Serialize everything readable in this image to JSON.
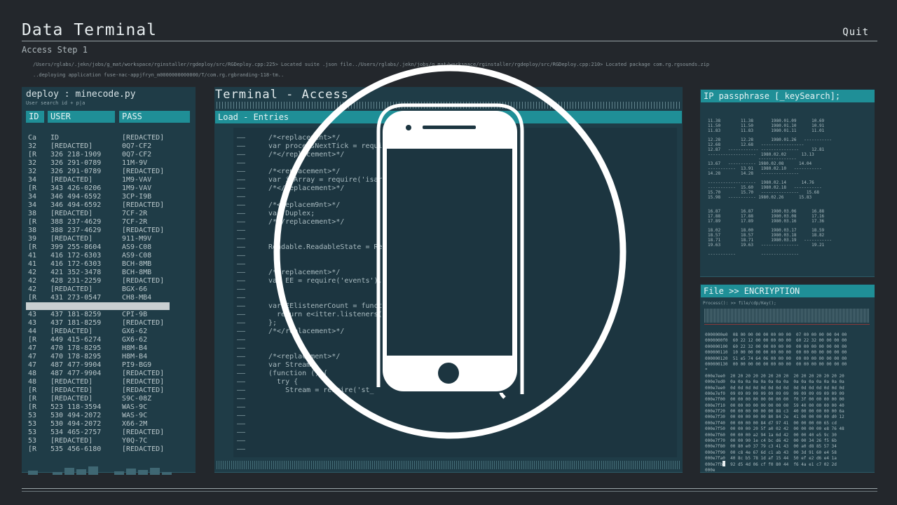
{
  "window": {
    "title": "Data Terminal",
    "quit_label": "Quit",
    "step": "Access Step 1"
  },
  "paths": [
    "/Users/rglabs/.jekn/jobs/g_mat/workspace/rginstaller/rgdeploy/src/RGDeploy.cpp:225> Located suite .json file../Users/rglabs/.jekn/jobs/g_mat/workspace/rginstaller/rgdeploy/src/RGDeploy.cpp:210> Located package com.rg.rgsounds.zip",
    "..deploying application fuse-nac-appjfryn_m0000000000000/T/com.rg.rgbranding-118-tm.."
  ],
  "deploy": {
    "title": "deploy : minecode.py",
    "subtitle": "User search id + p|a",
    "columns": [
      "ID",
      "USER",
      "PASS"
    ],
    "rows": [
      [
        "Ca",
        "ID",
        "[REDACTED]"
      ],
      [
        "32",
        "[REDACTED]",
        "0Q7-CF2"
      ],
      [
        "[R",
        "326 218-1909",
        "0Q7-CF2"
      ],
      [
        "32",
        "326 291-0789",
        "11M-9V"
      ],
      [
        "32",
        "326 291-0789",
        "[REDACTED]"
      ],
      [
        "34",
        "[REDACTED]",
        "1M9-VAV"
      ],
      [
        "[R",
        "343 426-0206",
        "1M9-VAV"
      ],
      [
        "34",
        "346 494-6592",
        "3CP-I9B"
      ],
      [
        "34",
        "346 494-6592",
        "[REDACTED]"
      ],
      [
        "38",
        "[REDACTED]",
        "7CF-2R"
      ],
      [
        "[R",
        "388 237-4629",
        "7CF-2R"
      ],
      [
        "38",
        "388 237-4629",
        "[REDACTED]"
      ],
      [
        "39",
        "[REDACTED]",
        "911-M9V"
      ],
      [
        "[R",
        "399 255-8604",
        "AS9-C08"
      ],
      [
        "41",
        "416 172-6303",
        "AS9-C08"
      ],
      [
        "41",
        "416 172-6303",
        "BCH-8MB"
      ],
      [
        "42",
        "421 352-3478",
        "BCH-8MB"
      ],
      [
        "42",
        "428 231-2259",
        "[REDACTED]"
      ],
      [
        "42",
        "[REDACTED]",
        "BGX-66"
      ],
      [
        "[R",
        "431 273-0547",
        "CH8-MB4"
      ],
      [
        "",
        "",
        ""
      ],
      [
        "43",
        "437 181-8259",
        "CPI-9B"
      ],
      [
        "43",
        "437 181-8259",
        "[REDACTED]"
      ],
      [
        "44",
        "[REDACTED]",
        "GX6-62"
      ],
      [
        "[R",
        "449 415-6274",
        "GX6-62"
      ],
      [
        "47",
        "470 178-8295",
        "H8M-B4"
      ],
      [
        "47",
        "470 178-8295",
        "H8M-B4"
      ],
      [
        "47",
        "487 477-9904",
        "PI9-BG9"
      ],
      [
        "48",
        "487 477-9904",
        "[REDACTED]"
      ],
      [
        "48",
        "[REDACTED]",
        "[REDACTED]"
      ],
      [
        "[R",
        "[REDACTED]",
        "[REDACTED]"
      ],
      [
        "[R",
        "[REDACTED]",
        "S9C-08Z"
      ],
      [
        "[R",
        "523 118-3594",
        "WAS-9C"
      ],
      [
        "53",
        "530 494-2072",
        "WAS-9C"
      ],
      [
        "53",
        "530 494-2072",
        "X66-2M"
      ],
      [
        "53",
        "534 465-2757",
        "[REDACTED]"
      ],
      [
        "53",
        "[REDACTED]",
        "Y0Q-7C"
      ],
      [
        "[R",
        "535 456-6180",
        "[REDACTED]"
      ]
    ]
  },
  "terminal": {
    "title": "Terminal - Access",
    "section": "Load - Entries",
    "dash": "——",
    "code": [
      "/*<replacement>*/",
      "var processNextTick = require('process-nextick-args');",
      "/*</replacement>*/",
      "",
      "/*<replacement>*/",
      "var isArray = require('isarray');",
      "/*</replacement>*/",
      "",
      "/*<replacem9nt>*/",
      "var Duplex;",
      "/*</replacement>*/",
      "",
      "",
      "Readable.ReadableState = ReadableState;",
      "",
      "",
      "/*<replacement>*/",
      "var EE = require('events').EventEmitter;",
      "",
      "",
      "var EElistenerCount = function (emitter, type) {",
      "  return e<itter.listeners(type).length;",
      "};",
      "/*</replacement>*/",
      "",
      "",
      "/*<replacement>*/",
      "var Stream;",
      "(function () {",
      "  try {",
      "    Stream = require('st_"
    ]
  },
  "ip": {
    "title": "IP passphrase [_keySearch];",
    "rows": [
      "11.38        11.38       1980.01.09      10.69",
      "11.50        11.50       1980.01.10      10.91",
      "11.83        11.83       1980.01.11      11.01",
      "",
      "12.28        12.28       1980.01.26   -----------",
      "12.68        12.68   -----------------",
      "12.87   ------------ ---------------     12.81",
      "-------------------  1980.02.02      13.13",
      "                    ---------------",
      "13.67   ----------- 1980.02.08      14.04",
      "-----------  13.91   1980.02.10   -----------",
      "14.28        14.28   ---------------",
      "",
      "-------------------  1980.02.14      14.76",
      "-----------  15.60   1980.02.18   -----------",
      "15.70        15.70   ---------------   15.68",
      "15.98   ----------- 1980.02.26      15.83",
      "",
      "",
      "16.87        16.87       1980.03.06      16.88",
      "17.88        17.88       1980.03.08      17.16",
      "17.89        17.89       1980.03.16      17.36",
      "",
      "18.02        18.00       1980.03.17      18.59",
      "18.57        18.57       1980.03.18      18.82",
      "18.71        18.71       1980.03.19   -----------",
      "19.63        19.63   ---------------     19.21",
      "",
      "-----------          ---------------"
    ]
  },
  "encryption": {
    "title": "File >> ENCRIYPTION",
    "subtitle": "Process(): >> file/cdp/Key();",
    "hex": [
      "0000000e0  08 00 00 00 00 00 00 00  07 00 00 00 00 04 00",
      "0000000f0  60 22 12 00 00 00 00 00  60 22 32 00 00 00 00",
      "000000100  60 22 32 00 00 00 00 00  00 00 00 00 00 00 00",
      "000000110  10 00 00 00 00 00 00 00  00 00 00 00 00 00 00",
      "000000120  51 e5 74 64 06 00 00 00  00 00 00 00 00 00 00",
      "000000130  00 00 00 00 00 00 00 00  00 00 00 00 00 00 00",
      "*",
      "000e7ee0  20 20 20 20 20 20 20 20  20 20 20 20 20 20 20",
      "000e7ed0  0a 0a 0a 0a 0a 0a 0a 0a  0a 0a 0a 0a 0a 0a 0a",
      "000e7ee0  0d 0d 0d 0d 0d 0d 0d 0d  0d 0d 0d 0d 0d 0d 0d",
      "000e7ef0  09 09 09 09 09 09 09 09  09 09 09 09 09 09 09",
      "000e7f00  00 00 00 00 00 00 00 00  f0 3f 00 00 00 00 00",
      "000e7f10  00 00 00 00 00 00 00 00  59 40 00 00 00 00 40",
      "000e7f20  00 00 00 00 00 00 88 c3  40 00 00 00 00 00 6a",
      "000e7f30  00 00 00 00 00 80 84 2e  41 00 00 00 00 d0 12",
      "000e7f40  00 00 00 00 84 d7 97 41  00 00 00 00 65 cd",
      "000e7f50  00 00 00 20 5f a0 02 42  00 00 00 00 e8 76 48",
      "000e7f60  00 00 00 a2 94 1a 6d 42  00 00 40 e5 9c 30",
      "000e7f70  00 00 90 1e c4 bc d6 42  00 00 34 26 f5 6b",
      "000e7f80  00 80 e0 37 79 c3 41 43  00 a0 d8 85 57 34",
      "000e7f90  00 c8 4e 67 6d c1 ab 43  00 3d 91 60 e4 58",
      "000e7fa0  40 8c b5 78 1d af 15 44  50 ef e2 d6 e4 1a",
      "000e7fb0  92 d5 4d 06 cf f0 80 44  f6 4a e1 c7 02 2d",
      "000e"
    ]
  }
}
